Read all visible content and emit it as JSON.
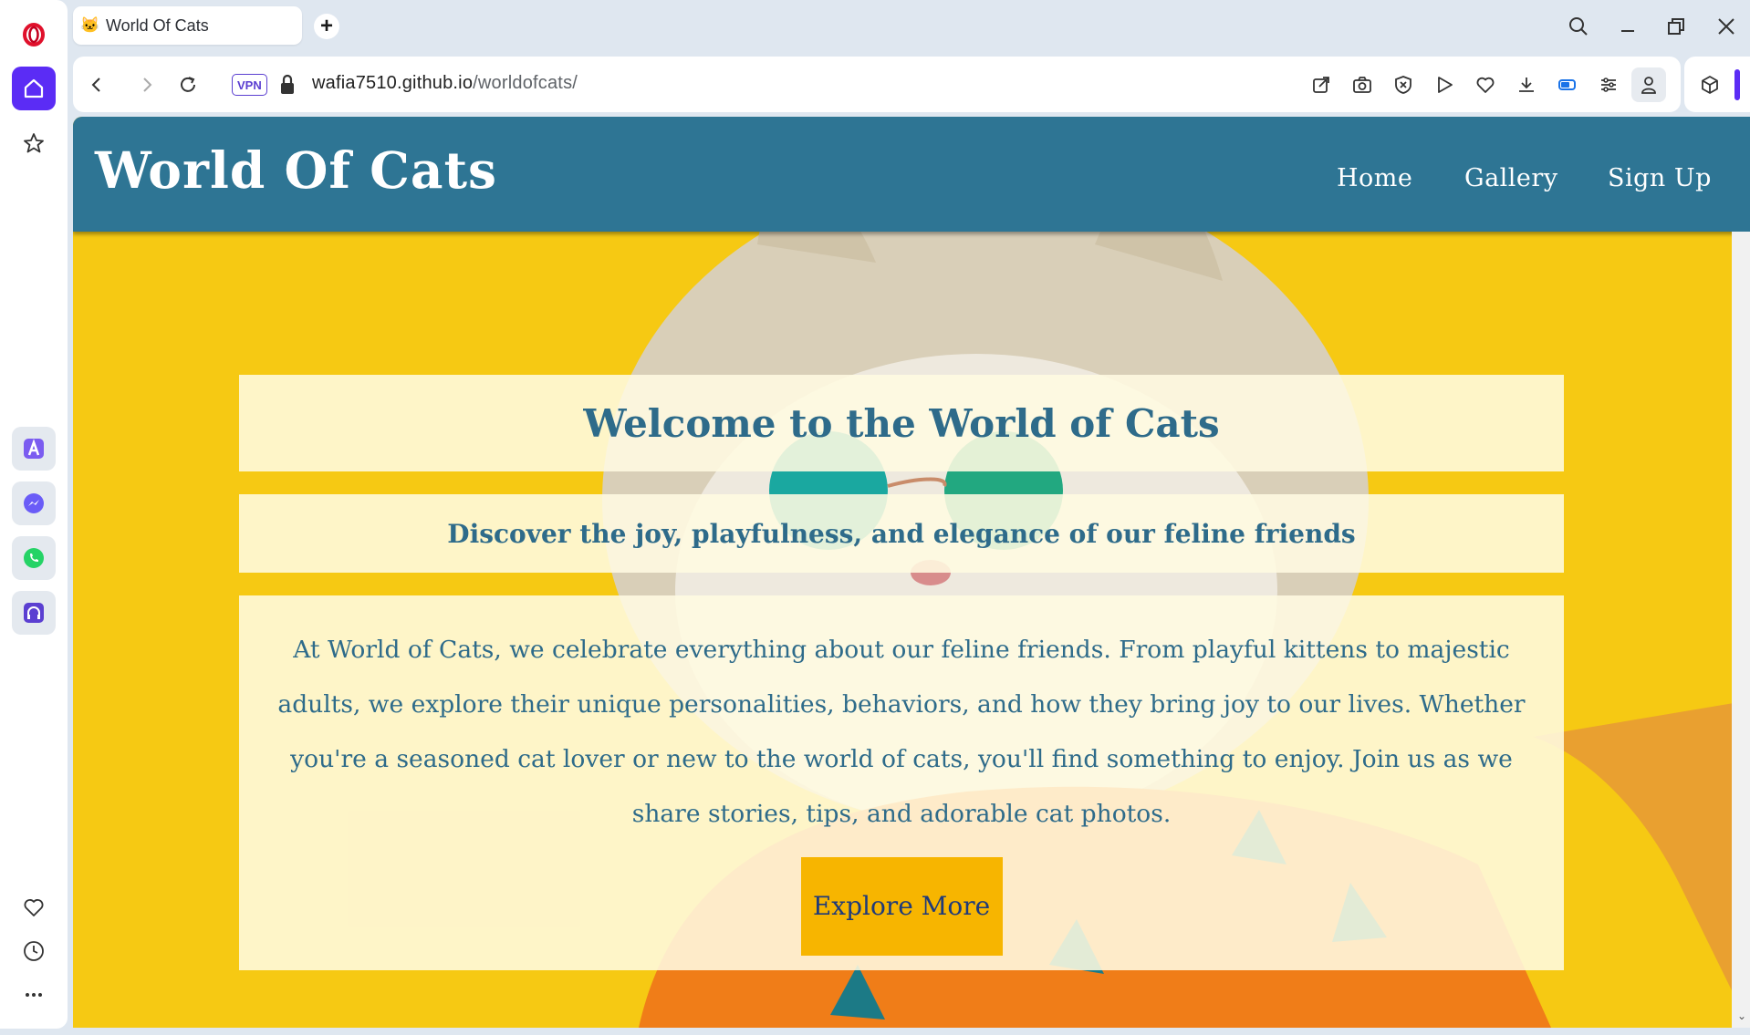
{
  "browser": {
    "tab": {
      "title": "World Of Cats",
      "favicon": "cat-face-icon"
    },
    "address_bar": {
      "vpn_label": "VPN",
      "url_domain": "wafia7510.github.io",
      "url_path": "/worldofcats/"
    },
    "accent_color": "#5b2cf5",
    "sidebar_icons": [
      "opera-logo-icon",
      "home-icon",
      "bookmarks-star-icon",
      "aria-icon",
      "messenger-icon",
      "whatsapp-icon",
      "music-player-icon",
      "heart-icon",
      "history-clock-icon",
      "more-dots-icon"
    ],
    "toolbar_icons": [
      "back-icon",
      "forward-icon",
      "reload-icon",
      "lock-icon",
      "share-icon",
      "camera-icon",
      "adblock-icon",
      "play-icon",
      "heart-icon",
      "download-icon",
      "battery-icon",
      "easy-setup-icon",
      "profile-icon",
      "extensions-cube-icon"
    ]
  },
  "site": {
    "logo": "World Of Cats",
    "nav": {
      "home": "Home",
      "gallery": "Gallery",
      "signup": "Sign Up"
    },
    "hero": {
      "title": "Welcome to the World of Cats",
      "subtitle": "Discover the joy, playfulness, and elegance of our feline friends",
      "body": "At World of Cats, we celebrate everything about our feline friends. From playful kittens to majestic adults, we explore their unique personalities, behaviors, and how they bring joy to our lives. Whether you're a seasoned cat lover or new to the world of cats, you'll find something to enjoy. Join us as we share stories, tips, and adorable cat photos.",
      "cta": "Explore More"
    },
    "colors": {
      "nav": "#2e7594",
      "heading_text": "#2e6b8a",
      "background": "#f6c913",
      "button": "#f7b500"
    }
  }
}
